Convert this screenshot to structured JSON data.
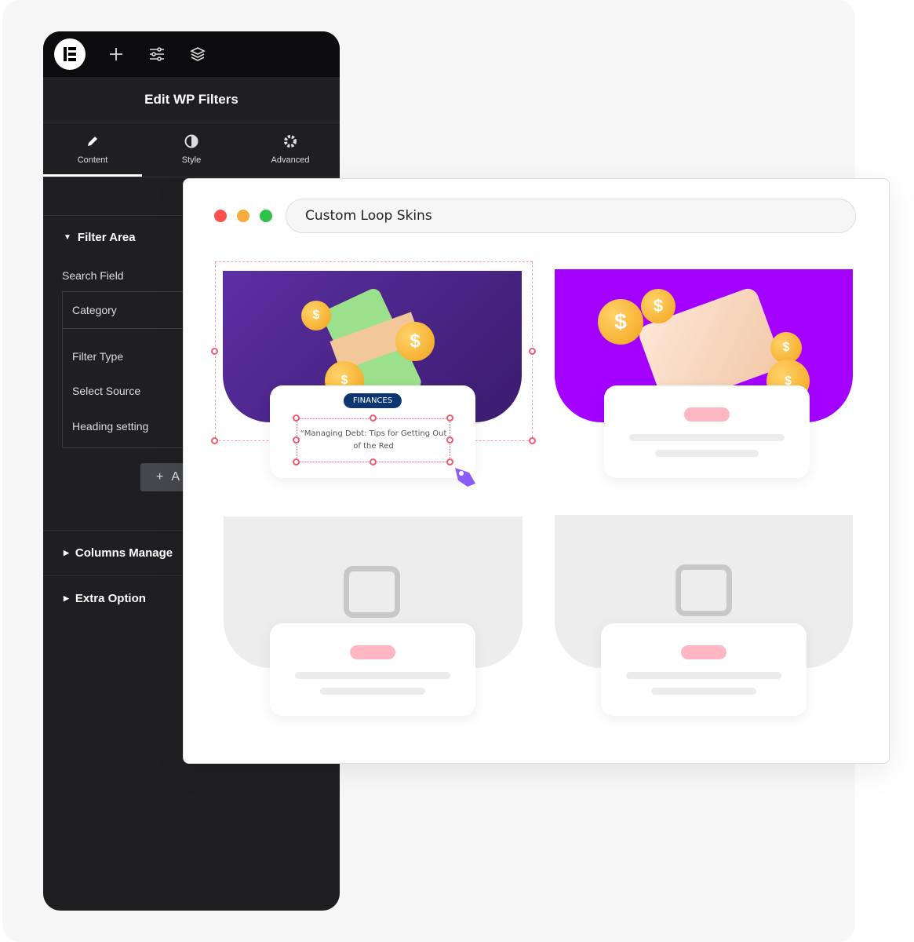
{
  "sidebar": {
    "toolbar": {
      "icons": [
        "elementor-logo-icon",
        "plus-icon",
        "sliders-icon",
        "layers-icon"
      ]
    },
    "title": "Edit WP Filters",
    "tabs": [
      {
        "label": "Content",
        "icon": "pencil-icon",
        "active": true
      },
      {
        "label": "Style",
        "icon": "contrast-icon"
      },
      {
        "label": "Advanced",
        "icon": "gear-icon"
      }
    ],
    "sections": {
      "filter_area": "Filter Area",
      "search_field": "Search Field",
      "category": "Category",
      "filter_type": "Filter Type",
      "select_source": "Select Source",
      "heading_setting": "Heading setting",
      "add_button": "A",
      "columns_manage": "Columns Manage",
      "extra_option": "Extra Option"
    }
  },
  "window": {
    "traffic_lights": [
      "#ff5050",
      "#f7ab3a",
      "#2ec24a"
    ],
    "url": "Custom Loop Skins",
    "cards": [
      {
        "badge": "FINANCES",
        "title": "“Managing Debt: Tips for Getting Out of the Red"
      }
    ]
  },
  "colors": {
    "accent_purple": "#a300ff",
    "badge": "#0e3670",
    "selection": "#f05a6e"
  }
}
